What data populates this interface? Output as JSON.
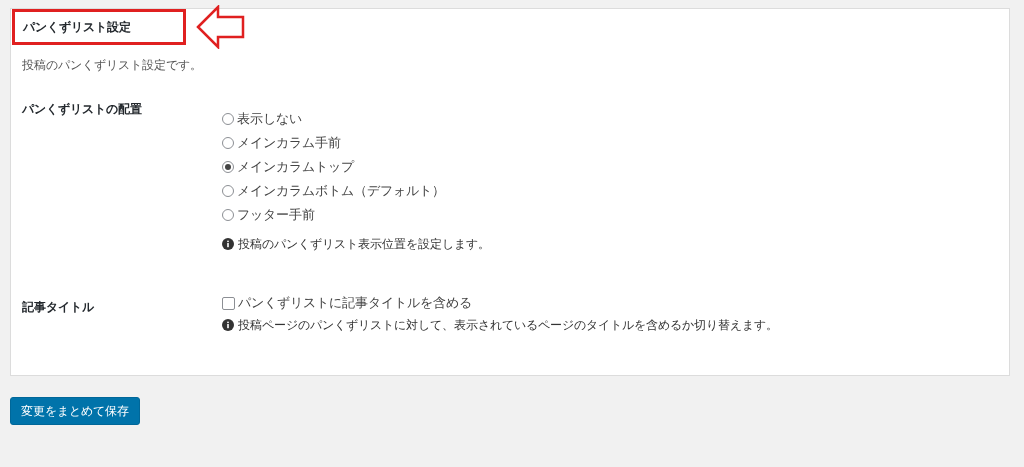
{
  "panel": {
    "title": "パンくずリスト設定",
    "title_highlighted": true,
    "description": "投稿のパンくずリスト設定です。",
    "settings": [
      {
        "kind": "radio",
        "label": "パンくずリストの配置",
        "options": [
          {
            "label": "表示しない",
            "selected": false
          },
          {
            "label": "メインカラム手前",
            "selected": false
          },
          {
            "label": "メインカラムトップ",
            "selected": true
          },
          {
            "label": "メインカラムボトム（デフォルト）",
            "selected": false
          },
          {
            "label": "フッター手前",
            "selected": false
          }
        ],
        "help": "投稿のパンくずリスト表示位置を設定します。"
      },
      {
        "kind": "checkbox",
        "label": "記事タイトル",
        "option": {
          "label": "パンくずリストに記事タイトルを含める",
          "checked": false
        },
        "help": "投稿ページのパンくずリストに対して、表示されているページのタイトルを含めるか切り替えます。"
      }
    ]
  },
  "save_button": "変更をまとめて保存"
}
